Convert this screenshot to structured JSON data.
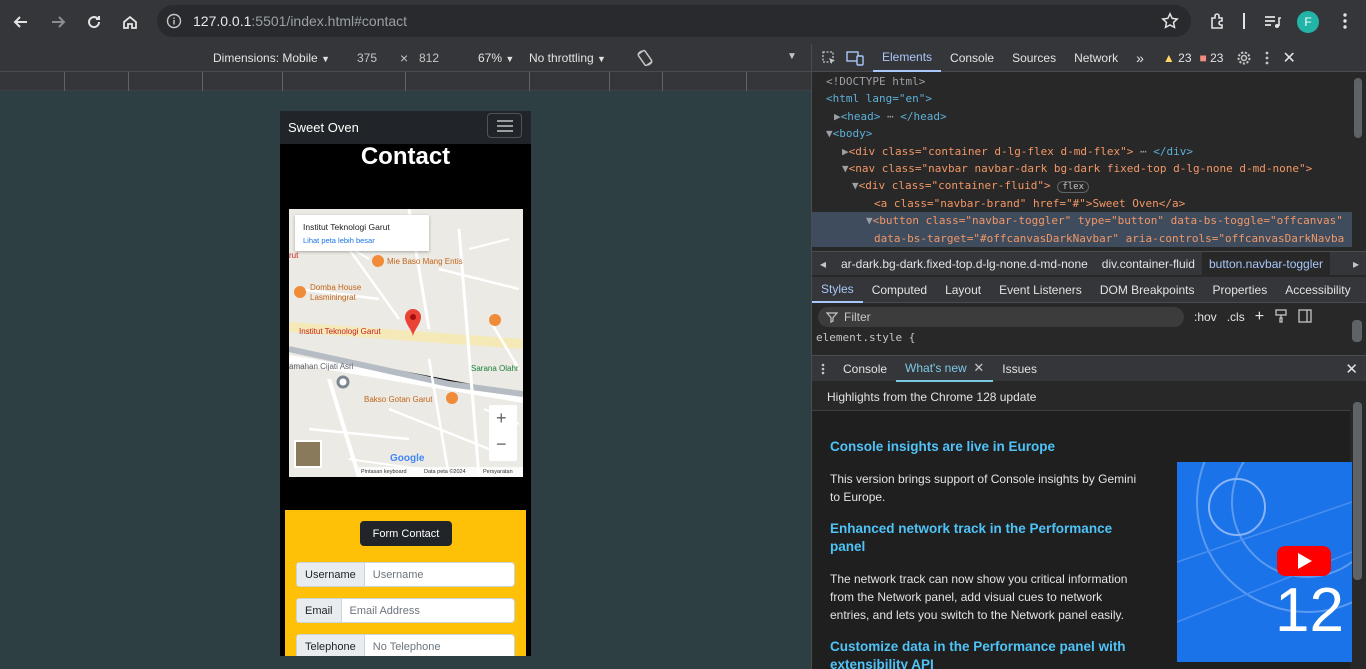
{
  "browser": {
    "url_host": "127.0.0.1",
    "url_rest": ":5501/index.html#contact",
    "profile_initial": "F"
  },
  "device_toolbar": {
    "dimensions_label": "Dimensions: Mobile",
    "width": "375",
    "times": "×",
    "height": "812",
    "zoom": "67%",
    "throttling": "No throttling"
  },
  "page": {
    "brand": "Sweet Oven",
    "title": "Contact",
    "map": {
      "place_name": "Institut Teknologi Garut",
      "larger_map_link": "Lihat peta lebih besar",
      "labels": [
        "Mie Baso Mang Entis",
        "Domba House",
        "Lasminingrat",
        "Institut Teknologi Garut",
        "amahan Cijati Asri",
        "Sarana Olahr",
        "Bakso Gotan Garut",
        "rut"
      ],
      "footer": [
        "Pintasan keyboard",
        "Data peta ©2024",
        "Persyaratan"
      ],
      "google": "Google",
      "zoom_in": "+",
      "zoom_out": "−"
    },
    "form": {
      "button": "Form Contact",
      "fields": [
        {
          "label": "Username",
          "placeholder": "Username"
        },
        {
          "label": "Email",
          "placeholder": "Email Address"
        },
        {
          "label": "Telephone",
          "placeholder": "No Telephone"
        }
      ]
    }
  },
  "devtools": {
    "tabs": [
      "Elements",
      "Console",
      "Sources",
      "Network"
    ],
    "warnings": "23",
    "errors": "23",
    "dom": [
      "<!DOCTYPE html>",
      "<html lang=\"en\">",
      "<head>",
      "<body>",
      "<div class=\"container d-lg-flex d-md-flex\">",
      "<nav class=\"navbar navbar-dark bg-dark fixed-top d-lg-none d-md-none\">",
      "<div class=\"container-fluid\">",
      "<a class=\"navbar-brand\" href=\"#\">Sweet Oven</a>",
      "<button class=\"navbar-toggler\" type=\"button\" data-bs-toggle=\"offcanvas\"",
      "data-bs-target=\"#offcanvasDarkNavbar\" aria-controls=\"offcanvasDarkNavba"
    ],
    "badge_flex": "flex",
    "crumbs": [
      "ar-dark.bg-dark.fixed-top.d-lg-none.d-md-none",
      "div.container-fluid",
      "button.navbar-toggler"
    ],
    "subtabs": [
      "Styles",
      "Computed",
      "Layout",
      "Event Listeners",
      "DOM Breakpoints",
      "Properties",
      "Accessibility"
    ],
    "filter": "Filter",
    "hov": ":hov",
    "cls": ".cls",
    "element_style": "element.style {",
    "drawer_tabs": [
      "Console",
      "What's new",
      "Issues"
    ],
    "highlights": "Highlights from the Chrome 128 update",
    "whatsnew": [
      {
        "title": "Console insights are live in Europe",
        "body": "This version brings support of Console insights by Gemini to Europe."
      },
      {
        "title": "Enhanced network track in the Performance panel",
        "body": "The network track can now show you critical information from the Network panel, add visual cues to network entries, and lets you switch to the Network panel easily."
      },
      {
        "title": "Customize data in the Performance panel with extensibility API",
        "body": ""
      }
    ],
    "video_number": "12"
  }
}
